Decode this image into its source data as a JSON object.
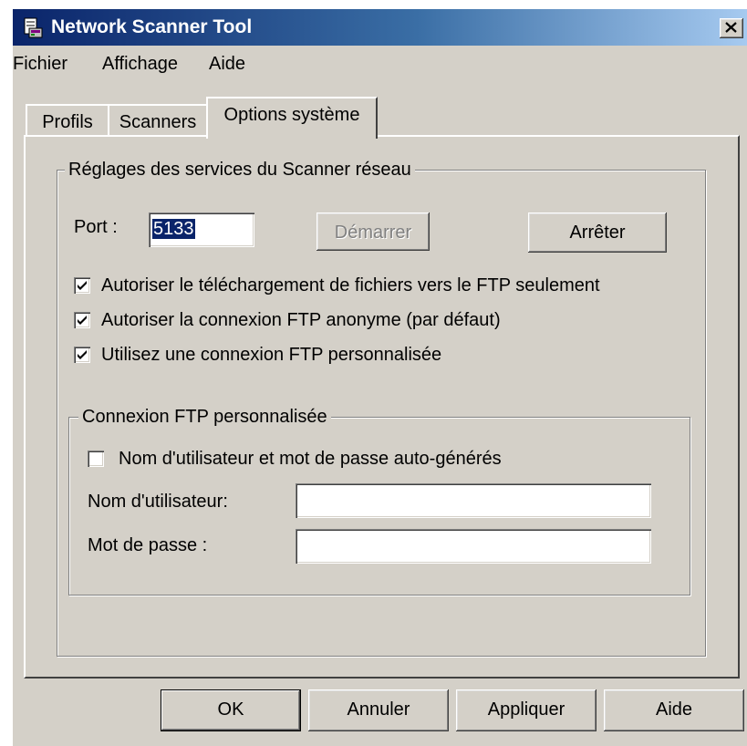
{
  "window": {
    "title": "Network Scanner Tool",
    "close_label": "x"
  },
  "menu": {
    "items": [
      "Fichier",
      "Affichage",
      "Aide"
    ]
  },
  "tabs": [
    {
      "label": "Profils",
      "active": false
    },
    {
      "label": "Scanners",
      "active": false
    },
    {
      "label": "Options système",
      "active": true
    }
  ],
  "services": {
    "legend": "Réglages des services du Scanner réseau",
    "port_label": "Port :",
    "port_value": "5133",
    "start_label": "Démarrer",
    "start_enabled": false,
    "stop_label": "Arrêter",
    "checkboxes": [
      {
        "label": "Autoriser le téléchargement de fichiers vers le FTP seulement",
        "checked": true
      },
      {
        "label": "Autoriser la connexion FTP anonyme (par défaut)",
        "checked": true
      },
      {
        "label": "Utilisez une connexion FTP personnalisée",
        "checked": true
      }
    ]
  },
  "custom_ftp": {
    "legend": "Connexion FTP personnalisée",
    "auto_generate": {
      "label": "Nom d'utilisateur et mot de passe auto-générés",
      "checked": false
    },
    "username_label": "Nom d'utilisateur:",
    "username_value": "",
    "password_label": "Mot de passe :",
    "password_value": ""
  },
  "buttons": {
    "ok": "OK",
    "cancel": "Annuler",
    "apply": "Appliquer",
    "help": "Aide"
  },
  "colors": {
    "titlebar_start": "#0a246a",
    "titlebar_end": "#a6caf0",
    "face": "#d4d0c8",
    "selection": "#0a246a"
  }
}
